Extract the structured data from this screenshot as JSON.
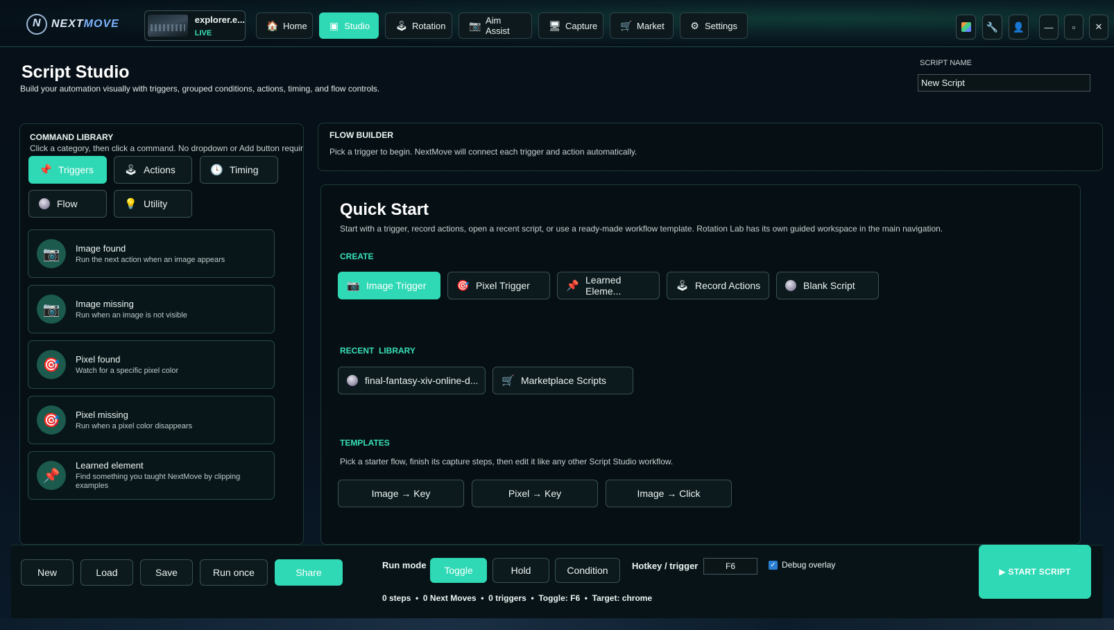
{
  "brand": {
    "name_part1": "NEXT",
    "name_part2": "MOVE"
  },
  "account": {
    "name": "explorer.e...",
    "status": "LIVE"
  },
  "nav": [
    {
      "label": "Home",
      "icon": "🏠"
    },
    {
      "label": "Studio",
      "icon": "▣"
    },
    {
      "label": "Rotation",
      "icon": "🕹"
    },
    {
      "label": "Aim Assist",
      "icon": "📷"
    },
    {
      "label": "Capture",
      "icon": "🖥"
    },
    {
      "label": "Market",
      "icon": "🛒"
    },
    {
      "label": "Settings",
      "icon": "⚙"
    }
  ],
  "page": {
    "title": "Script Studio",
    "subtitle": "Build your automation visually with triggers, grouped conditions, actions, timing, and flow controls.",
    "script_name_label": "SCRIPT NAME",
    "script_name_value": "New Script"
  },
  "library": {
    "title": "COMMAND LIBRARY",
    "hint": "Click a category, then click a command. No dropdown or Add button required.",
    "categories": [
      {
        "label": "Triggers",
        "icon": "📌"
      },
      {
        "label": "Actions",
        "icon": "🕹"
      },
      {
        "label": "Timing",
        "icon": "🕓"
      },
      {
        "label": "Flow",
        "icon": ""
      },
      {
        "label": "Utility",
        "icon": "💡"
      }
    ],
    "commands": [
      {
        "title": "Image found",
        "desc": "Run the next action when an image appears",
        "icon": "📷"
      },
      {
        "title": "Image missing",
        "desc": "Run when an image is not visible",
        "icon": "📷"
      },
      {
        "title": "Pixel found",
        "desc": "Watch for a specific pixel color",
        "icon": "🎯"
      },
      {
        "title": "Pixel missing",
        "desc": "Run when a pixel color disappears",
        "icon": "🎯"
      },
      {
        "title": "Learned element",
        "desc": "Find something you taught NextMove by clipping examples",
        "icon": "📌"
      }
    ]
  },
  "flow_builder": {
    "title": "FLOW BUILDER",
    "hint": "Pick a trigger to begin. NextMove will connect each trigger and action automatically."
  },
  "quick_start": {
    "title": "Quick Start",
    "subtitle": "Start with a trigger, record actions, open a recent script, or use a ready-made workflow template. Rotation Lab has its own guided workspace in the main navigation.",
    "create_label": "CREATE",
    "create": [
      {
        "label": "Image Trigger",
        "icon": "📷"
      },
      {
        "label": "Pixel Trigger",
        "icon": "🎯"
      },
      {
        "label": "Learned Eleme...",
        "icon": "📌"
      },
      {
        "label": "Record Actions",
        "icon": "🕹"
      },
      {
        "label": "Blank Script",
        "icon": ""
      }
    ],
    "recent_label": "RECENT  LIBRARY",
    "recent": [
      {
        "label": "final-fantasy-xiv-online-d...",
        "icon": ""
      },
      {
        "label": "Marketplace Scripts",
        "icon": "🛒"
      }
    ],
    "templates_label": "TEMPLATES",
    "templates_hint": "Pick a starter flow, finish its capture steps, then edit it like any other Script Studio workflow.",
    "templates": [
      "Image → Key",
      "Pixel → Key",
      "Image → Click"
    ]
  },
  "footer": {
    "buttons": [
      "New",
      "Load",
      "Save",
      "Run once",
      "Share"
    ],
    "run_mode_label": "Run mode",
    "run_modes": [
      "Toggle",
      "Hold",
      "Condition"
    ],
    "hotkey_label": "Hotkey / trigger",
    "hotkey_value": "F6",
    "debug_label": "Debug overlay",
    "stats": "0 steps  •  0 Next Moves  •  0 triggers  •  Toggle: F6  •  Target: chrome",
    "start_label": "▶ START SCRIPT"
  },
  "colors": {
    "accent": "#2fd9b5",
    "section_label": "#39e0b8",
    "background": "#061014"
  }
}
